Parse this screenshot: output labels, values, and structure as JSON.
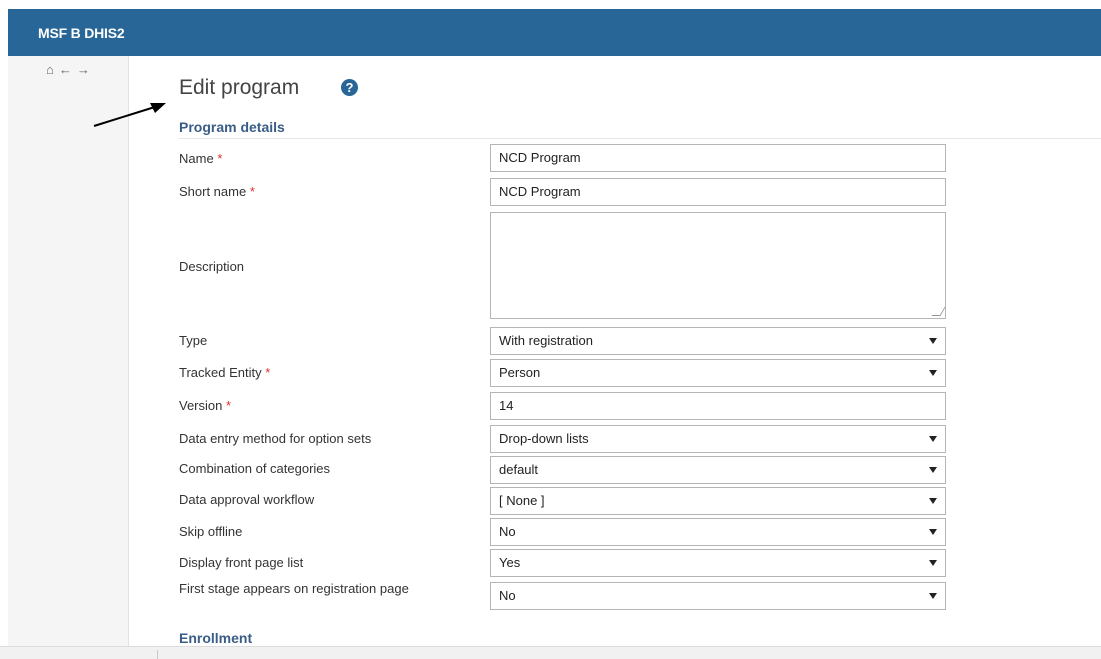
{
  "app": {
    "title": "MSF B DHIS2"
  },
  "page": {
    "title": "Edit program"
  },
  "sections": {
    "program_details": "Program details",
    "enrollment": "Enrollment"
  },
  "fields": {
    "name": {
      "label": "Name",
      "value": "NCD Program",
      "required": "*"
    },
    "short_name": {
      "label": "Short name",
      "value": "NCD Program",
      "required": "*"
    },
    "description": {
      "label": "Description",
      "value": ""
    },
    "type": {
      "label": "Type",
      "value": "With registration"
    },
    "tracked_entity": {
      "label": "Tracked Entity",
      "value": "Person",
      "required": "*"
    },
    "version": {
      "label": "Version",
      "value": "14",
      "required": "*"
    },
    "data_entry_method": {
      "label": "Data entry method for option sets",
      "value": "Drop-down lists"
    },
    "category_combo": {
      "label": "Combination of categories",
      "value": "default"
    },
    "approval_workflow": {
      "label": "Data approval workflow",
      "value": "[ None ]"
    },
    "skip_offline": {
      "label": "Skip offline",
      "value": "No"
    },
    "display_front_page": {
      "label": "Display front page list",
      "value": "Yes"
    },
    "first_stage_registration": {
      "label": "First stage appears on registration page",
      "value": "No"
    }
  },
  "colors": {
    "header": "#276696",
    "section": "#3a5d87",
    "required": "#dd3333"
  },
  "icons": [
    "home-icon",
    "back-arrow-icon",
    "forward-arrow-icon",
    "help-circle-icon",
    "annotation-arrow"
  ]
}
